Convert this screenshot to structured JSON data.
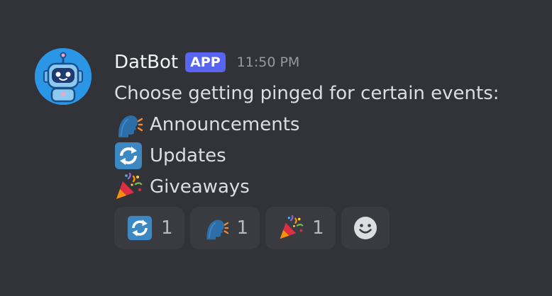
{
  "message": {
    "author": "DatBot",
    "badge": "APP",
    "timestamp": "11:50 PM",
    "intro": "Choose getting pinged for certain events:",
    "lines": [
      {
        "icon": "speaking-head-icon",
        "label": "Announcements"
      },
      {
        "icon": "refresh-arrows-icon",
        "label": "Updates"
      },
      {
        "icon": "party-popper-icon",
        "label": "Giveaways"
      }
    ]
  },
  "reactions": [
    {
      "icon": "refresh-arrows-icon",
      "count": "1"
    },
    {
      "icon": "speaking-head-icon",
      "count": "1"
    },
    {
      "icon": "party-popper-icon",
      "count": "1"
    }
  ],
  "colors": {
    "background": "#313338",
    "badge": "#5865f2",
    "avatar": "#2a96e5",
    "reaction_bg": "#393b41"
  }
}
